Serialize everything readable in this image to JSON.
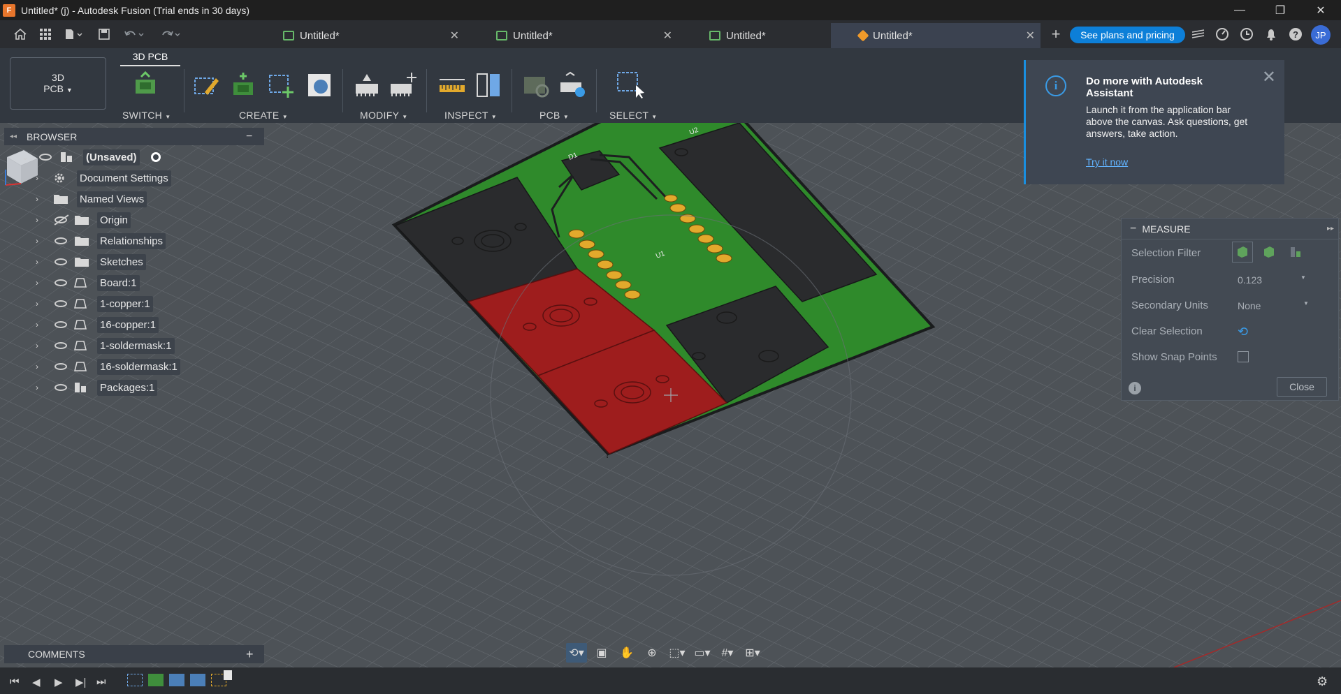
{
  "window": {
    "title": "Untitled* (j) - Autodesk Fusion (Trial ends in 30 days)",
    "logo": "F",
    "controls": [
      "—",
      "❐",
      "✕"
    ]
  },
  "tabs": [
    {
      "label": "Untitled*",
      "icon": "schematic-icon",
      "active": false
    },
    {
      "label": "Untitled*",
      "icon": "pcb-icon",
      "active": false
    },
    {
      "label": "Untitled*",
      "icon": "pcb-icon",
      "active": false
    },
    {
      "label": "Untitled*",
      "icon": "3d-component-icon",
      "active": true
    }
  ],
  "appbar": {
    "plans_label": "See plans and pricing",
    "avatar_initials": "JP"
  },
  "toolbar": {
    "workspace_line1": "3D",
    "workspace_line2": "PCB",
    "active_tab": "3D PCB",
    "groups": [
      "SWITCH",
      "CREATE",
      "MODIFY",
      "INSPECT",
      "PCB",
      "SELECT"
    ]
  },
  "browser": {
    "title": "BROWSER",
    "root_label": "(Unsaved)",
    "items": [
      {
        "label": "Document Settings",
        "icon": "gear-icon",
        "eye": false
      },
      {
        "label": "Named Views",
        "icon": "folder-icon",
        "eye": false
      },
      {
        "label": "Origin",
        "icon": "folder-icon",
        "eye": "hidden"
      },
      {
        "label": "Relationships",
        "icon": "folder-icon",
        "eye": true
      },
      {
        "label": "Sketches",
        "icon": "folder-icon",
        "eye": true
      },
      {
        "label": "Board:1",
        "icon": "body-icon",
        "eye": true
      },
      {
        "label": "1-copper:1",
        "icon": "body-icon",
        "eye": true
      },
      {
        "label": "16-copper:1",
        "icon": "body-icon",
        "eye": true
      },
      {
        "label": "1-soldermask:1",
        "icon": "body-icon",
        "eye": true
      },
      {
        "label": "16-soldermask:1",
        "icon": "body-icon",
        "eye": true
      },
      {
        "label": "Packages:1",
        "icon": "component-icon",
        "eye": true
      }
    ]
  },
  "assistant": {
    "title": "Do more with Autodesk Assistant",
    "body": "Launch it from the application bar above the canvas. Ask questions, get answers, take action.",
    "link": "Try it now"
  },
  "measure": {
    "title": "MEASURE",
    "rows": [
      {
        "label": "Selection Filter",
        "value": ""
      },
      {
        "label": "Precision",
        "value": "0.123"
      },
      {
        "label": "Secondary Units",
        "value": "None"
      },
      {
        "label": "Clear Selection",
        "value": ""
      },
      {
        "label": "Show Snap Points",
        "value": ""
      }
    ],
    "close_label": "Close"
  },
  "pcb_labels": {
    "d1": "D1",
    "u2": "U2",
    "u1": "U1"
  },
  "comments": {
    "title": "COMMENTS"
  },
  "colors": {
    "board_green": "#2f8a2b",
    "pad_red": "#9e1d1d",
    "pad_black": "#2a2b2d",
    "pin_gold": "#e2a92c",
    "accent": "#0d7fd8"
  }
}
